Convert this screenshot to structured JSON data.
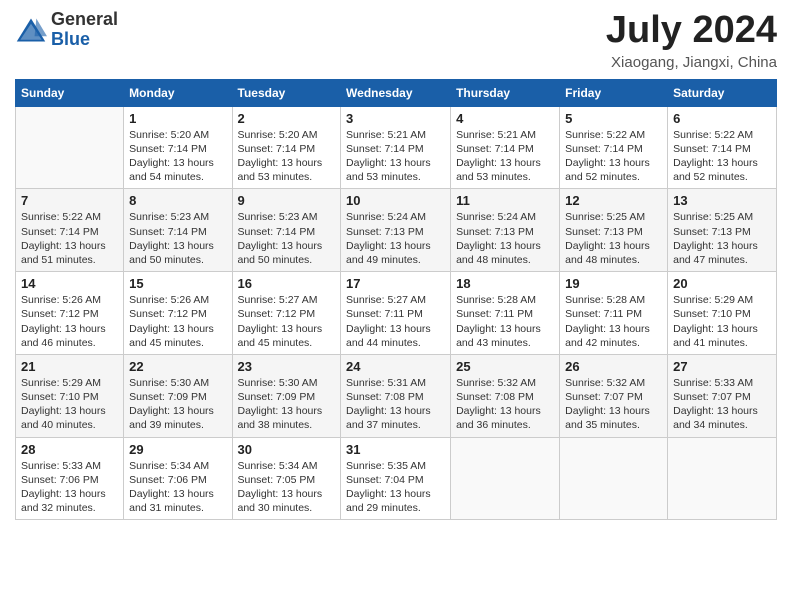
{
  "header": {
    "logo_general": "General",
    "logo_blue": "Blue",
    "title": "July 2024",
    "location": "Xiaogang, Jiangxi, China"
  },
  "days_of_week": [
    "Sunday",
    "Monday",
    "Tuesday",
    "Wednesday",
    "Thursday",
    "Friday",
    "Saturday"
  ],
  "weeks": [
    [
      {
        "day": "",
        "info": ""
      },
      {
        "day": "1",
        "info": "Sunrise: 5:20 AM\nSunset: 7:14 PM\nDaylight: 13 hours\nand 54 minutes."
      },
      {
        "day": "2",
        "info": "Sunrise: 5:20 AM\nSunset: 7:14 PM\nDaylight: 13 hours\nand 53 minutes."
      },
      {
        "day": "3",
        "info": "Sunrise: 5:21 AM\nSunset: 7:14 PM\nDaylight: 13 hours\nand 53 minutes."
      },
      {
        "day": "4",
        "info": "Sunrise: 5:21 AM\nSunset: 7:14 PM\nDaylight: 13 hours\nand 53 minutes."
      },
      {
        "day": "5",
        "info": "Sunrise: 5:22 AM\nSunset: 7:14 PM\nDaylight: 13 hours\nand 52 minutes."
      },
      {
        "day": "6",
        "info": "Sunrise: 5:22 AM\nSunset: 7:14 PM\nDaylight: 13 hours\nand 52 minutes."
      }
    ],
    [
      {
        "day": "7",
        "info": "Sunrise: 5:22 AM\nSunset: 7:14 PM\nDaylight: 13 hours\nand 51 minutes."
      },
      {
        "day": "8",
        "info": "Sunrise: 5:23 AM\nSunset: 7:14 PM\nDaylight: 13 hours\nand 50 minutes."
      },
      {
        "day": "9",
        "info": "Sunrise: 5:23 AM\nSunset: 7:14 PM\nDaylight: 13 hours\nand 50 minutes."
      },
      {
        "day": "10",
        "info": "Sunrise: 5:24 AM\nSunset: 7:13 PM\nDaylight: 13 hours\nand 49 minutes."
      },
      {
        "day": "11",
        "info": "Sunrise: 5:24 AM\nSunset: 7:13 PM\nDaylight: 13 hours\nand 48 minutes."
      },
      {
        "day": "12",
        "info": "Sunrise: 5:25 AM\nSunset: 7:13 PM\nDaylight: 13 hours\nand 48 minutes."
      },
      {
        "day": "13",
        "info": "Sunrise: 5:25 AM\nSunset: 7:13 PM\nDaylight: 13 hours\nand 47 minutes."
      }
    ],
    [
      {
        "day": "14",
        "info": "Sunrise: 5:26 AM\nSunset: 7:12 PM\nDaylight: 13 hours\nand 46 minutes."
      },
      {
        "day": "15",
        "info": "Sunrise: 5:26 AM\nSunset: 7:12 PM\nDaylight: 13 hours\nand 45 minutes."
      },
      {
        "day": "16",
        "info": "Sunrise: 5:27 AM\nSunset: 7:12 PM\nDaylight: 13 hours\nand 45 minutes."
      },
      {
        "day": "17",
        "info": "Sunrise: 5:27 AM\nSunset: 7:11 PM\nDaylight: 13 hours\nand 44 minutes."
      },
      {
        "day": "18",
        "info": "Sunrise: 5:28 AM\nSunset: 7:11 PM\nDaylight: 13 hours\nand 43 minutes."
      },
      {
        "day": "19",
        "info": "Sunrise: 5:28 AM\nSunset: 7:11 PM\nDaylight: 13 hours\nand 42 minutes."
      },
      {
        "day": "20",
        "info": "Sunrise: 5:29 AM\nSunset: 7:10 PM\nDaylight: 13 hours\nand 41 minutes."
      }
    ],
    [
      {
        "day": "21",
        "info": "Sunrise: 5:29 AM\nSunset: 7:10 PM\nDaylight: 13 hours\nand 40 minutes."
      },
      {
        "day": "22",
        "info": "Sunrise: 5:30 AM\nSunset: 7:09 PM\nDaylight: 13 hours\nand 39 minutes."
      },
      {
        "day": "23",
        "info": "Sunrise: 5:30 AM\nSunset: 7:09 PM\nDaylight: 13 hours\nand 38 minutes."
      },
      {
        "day": "24",
        "info": "Sunrise: 5:31 AM\nSunset: 7:08 PM\nDaylight: 13 hours\nand 37 minutes."
      },
      {
        "day": "25",
        "info": "Sunrise: 5:32 AM\nSunset: 7:08 PM\nDaylight: 13 hours\nand 36 minutes."
      },
      {
        "day": "26",
        "info": "Sunrise: 5:32 AM\nSunset: 7:07 PM\nDaylight: 13 hours\nand 35 minutes."
      },
      {
        "day": "27",
        "info": "Sunrise: 5:33 AM\nSunset: 7:07 PM\nDaylight: 13 hours\nand 34 minutes."
      }
    ],
    [
      {
        "day": "28",
        "info": "Sunrise: 5:33 AM\nSunset: 7:06 PM\nDaylight: 13 hours\nand 32 minutes."
      },
      {
        "day": "29",
        "info": "Sunrise: 5:34 AM\nSunset: 7:06 PM\nDaylight: 13 hours\nand 31 minutes."
      },
      {
        "day": "30",
        "info": "Sunrise: 5:34 AM\nSunset: 7:05 PM\nDaylight: 13 hours\nand 30 minutes."
      },
      {
        "day": "31",
        "info": "Sunrise: 5:35 AM\nSunset: 7:04 PM\nDaylight: 13 hours\nand 29 minutes."
      },
      {
        "day": "",
        "info": ""
      },
      {
        "day": "",
        "info": ""
      },
      {
        "day": "",
        "info": ""
      }
    ]
  ]
}
